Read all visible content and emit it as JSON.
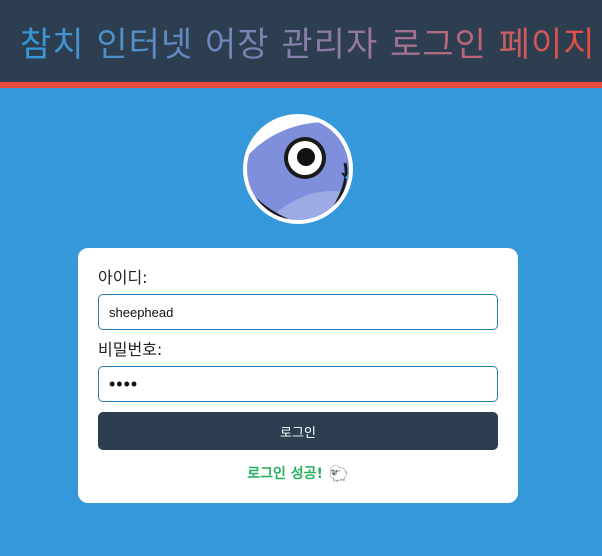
{
  "header": {
    "title": "참치 인터넷 어장 관리자 로그인 페이지"
  },
  "colors": {
    "header_bg": "#2c3e50",
    "header_border": "#e74c3c",
    "page_bg": "#3498db",
    "button_bg": "#2c3e50",
    "success": "#27ae60"
  },
  "avatar": {
    "icon": "tuna-fish-avatar-icon"
  },
  "login_form": {
    "username_label": "아이디:",
    "username_value": "sheephead",
    "password_label": "비밀번호:",
    "password_value": "••••",
    "submit_label": "로그인",
    "status_message": "로그인 성공!",
    "status_icon_glyph": "🐑",
    "status_icon": "sheep-icon"
  }
}
